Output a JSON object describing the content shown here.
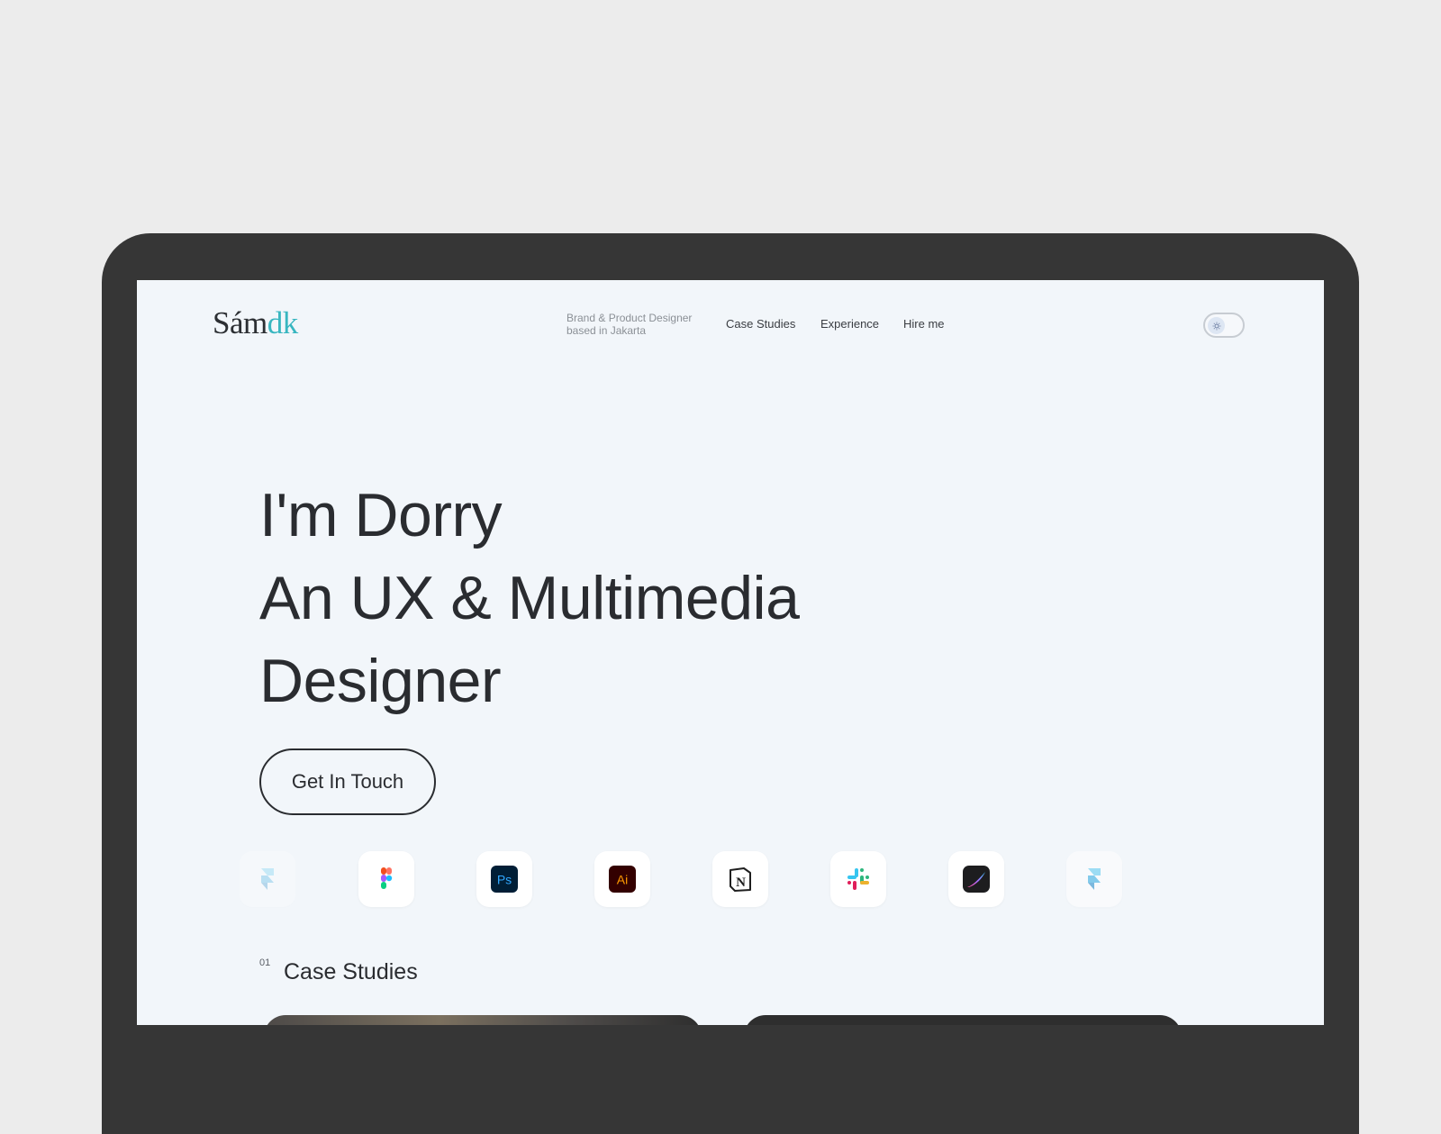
{
  "header": {
    "logo_main": "Sám",
    "logo_accent": "dk",
    "tagline_line1": "Brand & Product Designer",
    "tagline_line2": "based in Jakarta",
    "nav": [
      {
        "label": "Case Studies"
      },
      {
        "label": "Experience"
      },
      {
        "label": "Hire me"
      }
    ],
    "theme_toggle_icon": "sun-icon"
  },
  "hero": {
    "line1": "I'm Dorry",
    "line2": "An UX & Multimedia",
    "line3": "Designer",
    "cta_label": "Get In Touch"
  },
  "tools": [
    {
      "icon": "framer-icon"
    },
    {
      "icon": "figma-icon"
    },
    {
      "icon": "photoshop-icon",
      "text": "Ps"
    },
    {
      "icon": "illustrator-icon",
      "text": "Ai"
    },
    {
      "icon": "notion-icon",
      "text": "N"
    },
    {
      "icon": "slack-icon"
    },
    {
      "icon": "procreate-icon"
    },
    {
      "icon": "framer-icon"
    }
  ],
  "case_studies": {
    "number": "01",
    "title": "Case Studies"
  },
  "colors": {
    "accent": "#38b6c0",
    "text": "#2a2c30",
    "screen_bg": "#f2f6fa",
    "device": "#363636"
  }
}
